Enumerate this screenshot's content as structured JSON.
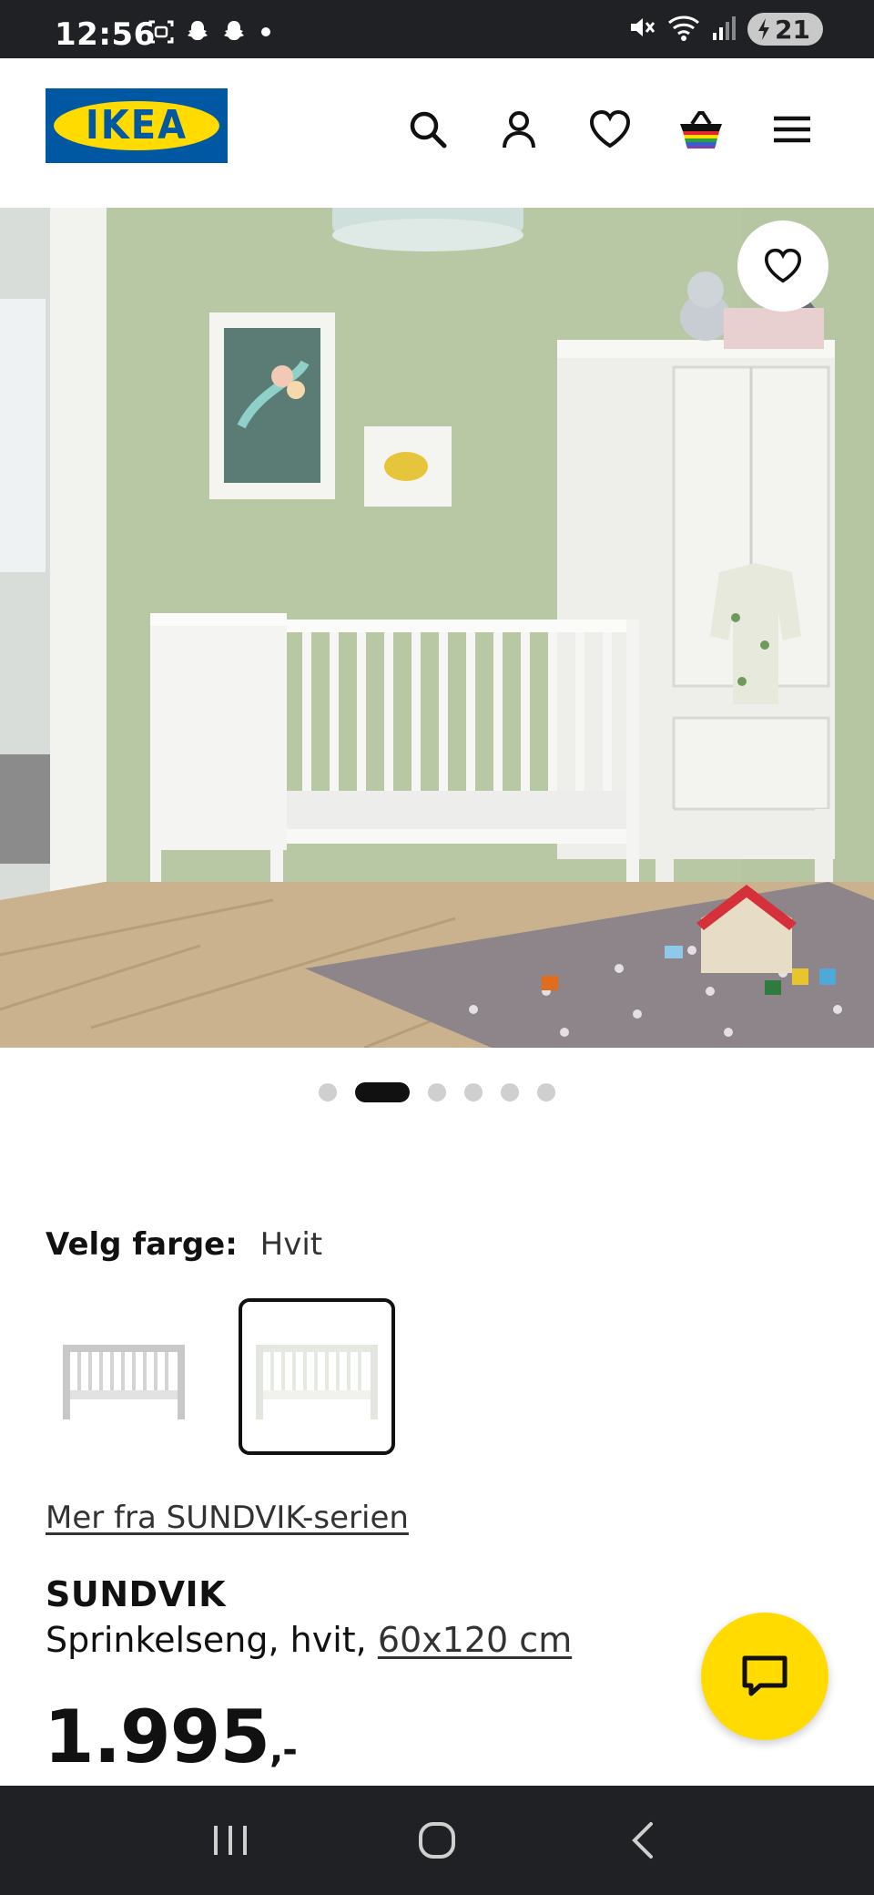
{
  "status_bar": {
    "time": "12:56",
    "battery": "21",
    "left_icons": [
      "screenshot-icon",
      "snapchat-icon",
      "snapchat-icon",
      "dot-icon"
    ],
    "right_icons": [
      "mute-icon",
      "wifi-icon",
      "signal-icon",
      "battery-icon"
    ]
  },
  "header": {
    "logo_text": "IKEA",
    "icons": [
      "search-icon",
      "account-icon",
      "heart-icon",
      "basket-icon",
      "menu-icon"
    ]
  },
  "carousel": {
    "total_images": 6,
    "active_index": 1
  },
  "color_selection": {
    "label": "Velg farge:",
    "value": "Hvit",
    "options": 2,
    "selected_index": 1
  },
  "series_link": "Mer fra SUNDVIK-serien",
  "product": {
    "name": "SUNDVIK",
    "description": "Sprinkelseng, hvit,",
    "size": "60x120 cm",
    "price": "1.995",
    "price_suffix": ",-"
  },
  "colors": {
    "ikea_blue": "#0058a3",
    "ikea_yellow": "#ffdb00",
    "status_bar": "#202124"
  }
}
